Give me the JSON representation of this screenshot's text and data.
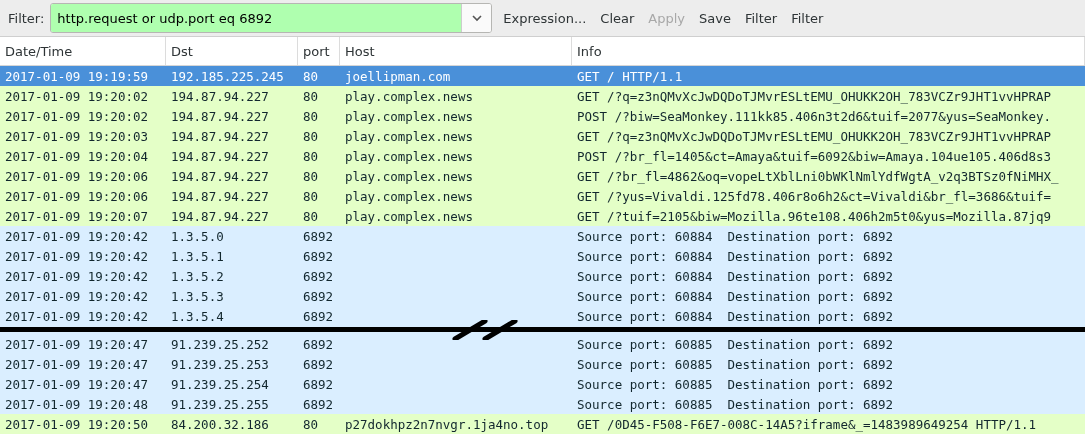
{
  "filter_bar": {
    "label": "Filter:",
    "value": "http.request or udp.port eq 6892",
    "buttons": [
      {
        "label": "Expression...",
        "disabled": false
      },
      {
        "label": "Clear",
        "disabled": false
      },
      {
        "label": "Apply",
        "disabled": true
      },
      {
        "label": "Save",
        "disabled": false
      },
      {
        "label": "Filter",
        "disabled": false
      },
      {
        "label": "Filter",
        "disabled": false
      }
    ]
  },
  "table": {
    "columns": [
      "Date/Time",
      "Dst",
      "port",
      "Host",
      "Info"
    ],
    "rows": [
      {
        "kind": "http",
        "selected": true,
        "cells": [
          "2017-01-09 19:19:59",
          "192.185.225.245",
          "80",
          "joellipman.com",
          "GET / HTTP/1.1"
        ]
      },
      {
        "kind": "http",
        "selected": false,
        "cells": [
          "2017-01-09 19:20:02",
          "194.87.94.227",
          "80",
          "play.complex.news",
          "GET /?q=z3nQMvXcJwDQDoTJMvrESLtEMU_OHUKK2OH_783VCZr9JHT1vvHPRAP"
        ]
      },
      {
        "kind": "http",
        "selected": false,
        "cells": [
          "2017-01-09 19:20:02",
          "194.87.94.227",
          "80",
          "play.complex.news",
          "POST /?biw=SeaMonkey.111kk85.406n3t2d6&tuif=2077&yus=SeaMonkey."
        ]
      },
      {
        "kind": "http",
        "selected": false,
        "cells": [
          "2017-01-09 19:20:03",
          "194.87.94.227",
          "80",
          "play.complex.news",
          "GET /?q=z3nQMvXcJwDQDoTJMvrESLtEMU_OHUKK2OH_783VCZr9JHT1vvHPRAP"
        ]
      },
      {
        "kind": "http",
        "selected": false,
        "cells": [
          "2017-01-09 19:20:04",
          "194.87.94.227",
          "80",
          "play.complex.news",
          "POST /?br_fl=1405&ct=Amaya&tuif=6092&biw=Amaya.104ue105.406d8s3"
        ]
      },
      {
        "kind": "http",
        "selected": false,
        "cells": [
          "2017-01-09 19:20:06",
          "194.87.94.227",
          "80",
          "play.complex.news",
          "GET /?br_fl=4862&oq=vopeLtXblLni0bWKlNmlYdfWgtA_v2q3BTSz0fNiMHX_"
        ]
      },
      {
        "kind": "http",
        "selected": false,
        "cells": [
          "2017-01-09 19:20:06",
          "194.87.94.227",
          "80",
          "play.complex.news",
          "GET /?yus=Vivaldi.125fd78.406r8o6h2&ct=Vivaldi&br_fl=3686&tuif="
        ]
      },
      {
        "kind": "http",
        "selected": false,
        "cells": [
          "2017-01-09 19:20:07",
          "194.87.94.227",
          "80",
          "play.complex.news",
          "GET /?tuif=2105&biw=Mozilla.96te108.406h2m5t0&yus=Mozilla.87jq9"
        ]
      },
      {
        "kind": "udp",
        "selected": false,
        "cells": [
          "2017-01-09 19:20:42",
          "1.3.5.0",
          "6892",
          "",
          "Source port: 60884  Destination port: 6892"
        ]
      },
      {
        "kind": "udp",
        "selected": false,
        "cells": [
          "2017-01-09 19:20:42",
          "1.3.5.1",
          "6892",
          "",
          "Source port: 60884  Destination port: 6892"
        ]
      },
      {
        "kind": "udp",
        "selected": false,
        "cells": [
          "2017-01-09 19:20:42",
          "1.3.5.2",
          "6892",
          "",
          "Source port: 60884  Destination port: 6892"
        ]
      },
      {
        "kind": "udp",
        "selected": false,
        "cells": [
          "2017-01-09 19:20:42",
          "1.3.5.3",
          "6892",
          "",
          "Source port: 60884  Destination port: 6892"
        ]
      },
      {
        "kind": "udp",
        "selected": false,
        "cells": [
          "2017-01-09 19:20:42",
          "1.3.5.4",
          "6892",
          "",
          "Source port: 60884  Destination port: 6892"
        ]
      },
      {
        "kind": "break"
      },
      {
        "kind": "udp",
        "selected": false,
        "cells": [
          "2017-01-09 19:20:47",
          "91.239.25.252",
          "6892",
          "",
          "Source port: 60885  Destination port: 6892"
        ]
      },
      {
        "kind": "udp",
        "selected": false,
        "cells": [
          "2017-01-09 19:20:47",
          "91.239.25.253",
          "6892",
          "",
          "Source port: 60885  Destination port: 6892"
        ]
      },
      {
        "kind": "udp",
        "selected": false,
        "cells": [
          "2017-01-09 19:20:47",
          "91.239.25.254",
          "6892",
          "",
          "Source port: 60885  Destination port: 6892"
        ]
      },
      {
        "kind": "udp",
        "selected": false,
        "cells": [
          "2017-01-09 19:20:48",
          "91.239.25.255",
          "6892",
          "",
          "Source port: 60885  Destination port: 6892"
        ]
      },
      {
        "kind": "http",
        "selected": false,
        "cells": [
          "2017-01-09 19:20:50",
          "84.200.32.186",
          "80",
          "p27dokhpz2n7nvgr.1ja4no.top",
          "GET /0D45-F508-F6E7-008C-14A5?iframe&_=1483989649254 HTTP/1.1"
        ]
      }
    ]
  }
}
